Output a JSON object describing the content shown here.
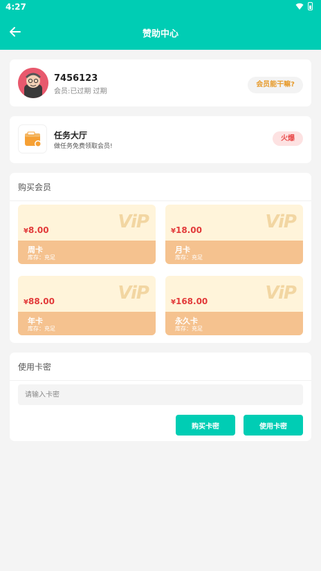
{
  "status_bar": {
    "time": "4:27"
  },
  "header": {
    "title": "赞助中心",
    "back_icon": "arrow-left-icon"
  },
  "profile": {
    "user_id": "7456123",
    "vip_status": "会员:已过期 过期",
    "action_label": "会员能干嘛?"
  },
  "task": {
    "title": "任务大厅",
    "subtitle": "做任务免费领取会员!",
    "badge": "火爆"
  },
  "buy": {
    "section_title": "购买会员",
    "plans": [
      {
        "price": "8.00",
        "currency": "¥",
        "name": "周卡",
        "stock": "库存：充足",
        "mark": "ViP"
      },
      {
        "price": "18.00",
        "currency": "¥",
        "name": "月卡",
        "stock": "库存：充足",
        "mark": "ViP"
      },
      {
        "price": "88.00",
        "currency": "¥",
        "name": "年卡",
        "stock": "库存：充足",
        "mark": "ViP"
      },
      {
        "price": "168.00",
        "currency": "¥",
        "name": "永久卡",
        "stock": "库存：充足",
        "mark": "ViP"
      }
    ]
  },
  "redeem": {
    "section_title": "使用卡密",
    "input_placeholder": "请输入卡密",
    "buy_button": "购买卡密",
    "use_button": "使用卡密"
  },
  "colors": {
    "accent": "#00cdb4",
    "price": "#e23a3a",
    "card_band": "#f5c28f"
  }
}
